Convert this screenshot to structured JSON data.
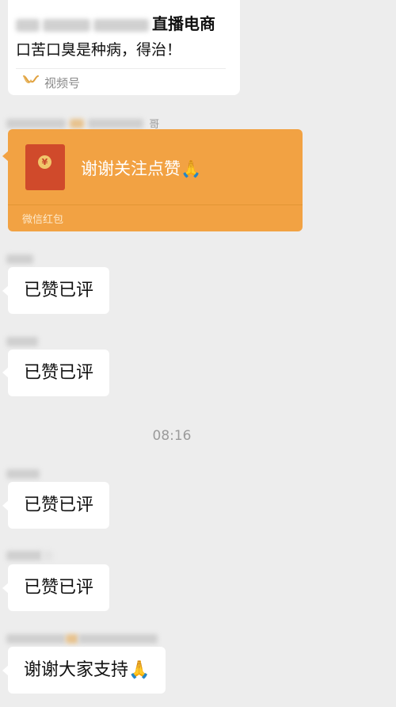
{
  "video_card": {
    "title": "直播电商",
    "subtitle": "口苦口臭是种病，得治！",
    "channel_label": "视频号"
  },
  "messages": [
    {
      "sender_suffix": "哥",
      "type": "red_packet",
      "text": "谢谢关注点赞🙏",
      "footer": "微信红包"
    },
    {
      "type": "text",
      "text": "已赞已评"
    },
    {
      "type": "text",
      "text": "已赞已评"
    },
    {
      "type": "text",
      "text": "已赞已评"
    },
    {
      "type": "text",
      "text": "已赞已评"
    },
    {
      "type": "text",
      "text": "谢谢大家支持🙏"
    }
  ],
  "timestamp": "08:16",
  "colors": {
    "background": "#ededed",
    "red_packet": "#f2a243",
    "bubble": "#ffffff"
  }
}
